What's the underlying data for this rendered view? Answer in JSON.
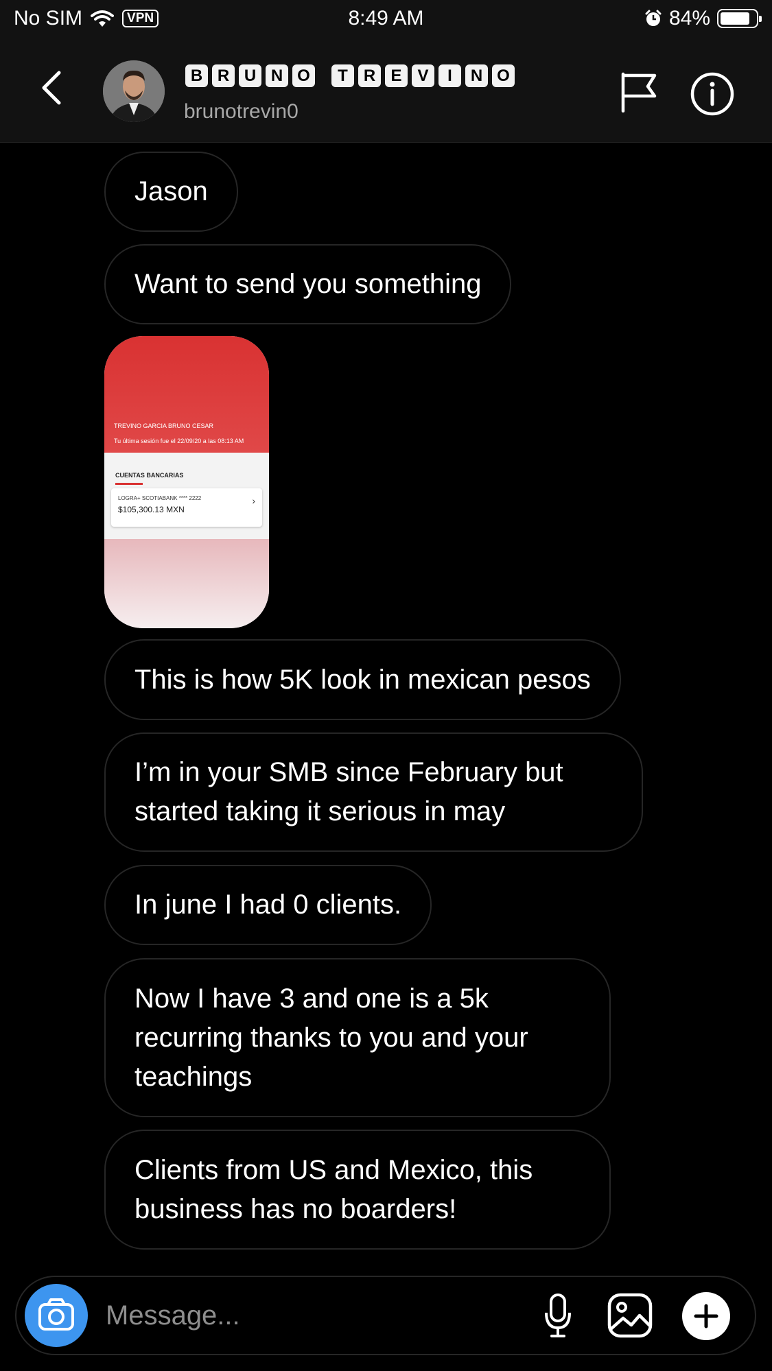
{
  "status_bar": {
    "carrier": "No SIM",
    "vpn": "VPN",
    "time": "8:49 AM",
    "battery": "84%",
    "battery_level": 0.84
  },
  "header": {
    "name_letters": [
      "B",
      "R",
      "U",
      "N",
      "O",
      " ",
      "T",
      "R",
      "E",
      "V",
      "I",
      "N",
      "O"
    ],
    "username": "brunotrevin0",
    "icons": [
      "back-icon",
      "flag-icon",
      "info-icon"
    ]
  },
  "messages": [
    {
      "text": "Jason"
    },
    {
      "text": "Want to send you something"
    },
    {
      "text": "This is how 5K look in mexican pesos"
    },
    {
      "text": "I’m in your SMB since February but started taking it serious in may"
    },
    {
      "text": "In june I had 0 clients."
    },
    {
      "text": "Now I have 3 and one is a 5k recurring thanks to you and your teachings"
    },
    {
      "text": "Clients from US and Mexico, this business has no boarders!"
    }
  ],
  "shared_image": {
    "header_name": "TREVINO GARCIA BRUNO CESAR",
    "last_session": "Tu última sesión fue el 22/09/20 a las 08:13 AM",
    "section_label": "CUENTAS BANCARIAS",
    "account_name": "LOGRA+ SCOTIABANK  **** 2222",
    "amount": "$105,300.13 MXN",
    "chevron": "›"
  },
  "composer": {
    "placeholder": "Message..."
  },
  "colors": {
    "background": "#000000",
    "bubble_border": "#262626",
    "camera_button": "#3d95ef",
    "muted_text": "#a8a8a8"
  }
}
